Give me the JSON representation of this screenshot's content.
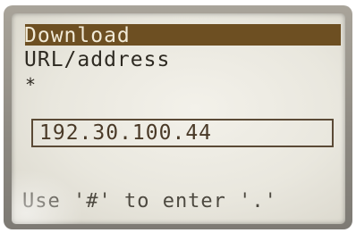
{
  "screen": {
    "title": "Download",
    "label": "URL/address",
    "star_glyph": "*",
    "ip_field": {
      "value": "192.30.100.44"
    },
    "hint": "Use '#' to enter '.'"
  },
  "colors": {
    "title_bar": "#6d4f22",
    "lcd_background": "#ecebe3",
    "text": "#2e2a22"
  }
}
